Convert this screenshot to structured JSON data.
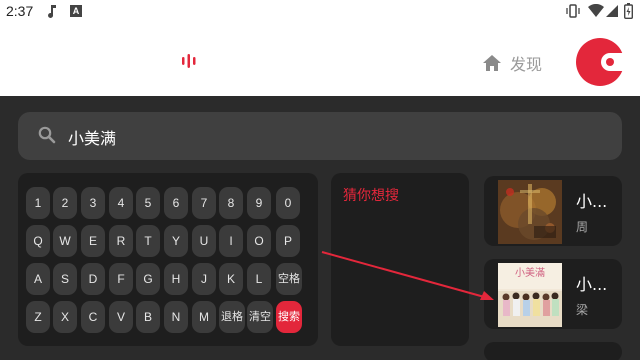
{
  "status_bar": {
    "time": "2:37",
    "notification_badge": "A"
  },
  "nav": {
    "discover_label": "发现",
    "brand_color": "#e3273b"
  },
  "search": {
    "query": "小美满"
  },
  "keyboard": {
    "rows": [
      [
        "1",
        "2",
        "3",
        "4",
        "5",
        "6",
        "7",
        "8",
        "9",
        "0"
      ],
      [
        "Q",
        "W",
        "E",
        "R",
        "T",
        "Y",
        "U",
        "I",
        "O",
        "P"
      ],
      [
        "A",
        "S",
        "D",
        "F",
        "G",
        "H",
        "J",
        "K",
        "L",
        "空格"
      ],
      [
        "Z",
        "X",
        "C",
        "V",
        "B",
        "N",
        "M",
        "退格",
        "清空",
        "搜索"
      ]
    ]
  },
  "suggestions": {
    "title": "猜你想搜"
  },
  "results": [
    {
      "title": "小...",
      "artist": "周"
    },
    {
      "title": "小...",
      "artist": "梁",
      "cover_text": "小美滿"
    }
  ],
  "colors": {
    "panel": "#1e1e1e",
    "background": "#2b2b2b",
    "key": "#3b3b3b",
    "accent": "#e3273b"
  }
}
